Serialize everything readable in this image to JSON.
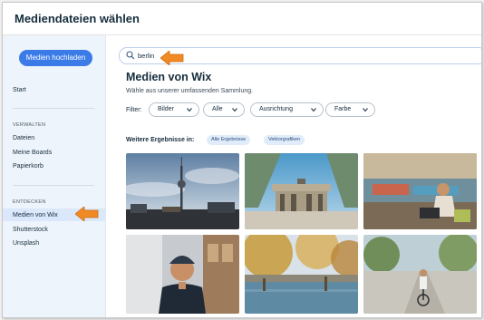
{
  "window": {
    "title": "Mediendateien wählen"
  },
  "sidebar": {
    "upload_label": "Medien hochladen",
    "start_label": "Start",
    "manage_heading": "VERWALTEN",
    "manage_items": [
      "Dateien",
      "Meine Boards",
      "Papierkorb"
    ],
    "discover_heading": "ENTDECKEN",
    "discover_items": [
      "Medien von Wix",
      "Shutterstock",
      "Unsplash"
    ]
  },
  "search": {
    "value": "berlin",
    "icon": "search-icon"
  },
  "main": {
    "heading": "Medien von Wix",
    "subheading": "Wähle aus unserer umfassenden Sammlung.",
    "filter_label": "Filter:",
    "filters": [
      "Bilder",
      "Alle",
      "Ausrichtung",
      "Farbe"
    ],
    "more_results_label": "Weitere Ergebnisse in:",
    "more_results_tags": [
      "Alle Ergebnisse",
      "Vektorgrafiken"
    ]
  },
  "colors": {
    "accent": "#3b7be8",
    "arrow": "#f08a24",
    "sidebar_bg": "#eef4fb",
    "selected_bg": "#dbe8fb"
  },
  "photos": [
    "tv-tower-photo",
    "brandenburg-gate-photo",
    "woman-laptop-photo",
    "man-beanie-photo",
    "river-autumn-photo",
    "cyclist-photo"
  ]
}
